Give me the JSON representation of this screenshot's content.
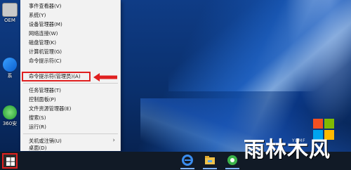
{
  "desktop": {
    "icons": [
      {
        "label": "OEM"
      },
      {
        "label": "系"
      },
      {
        "label": "360安"
      }
    ]
  },
  "context_menu": {
    "items": [
      {
        "label": "事件查看器(V)"
      },
      {
        "label": "系统(Y)"
      },
      {
        "label": "设备管理器(M)"
      },
      {
        "label": "网络连接(W)"
      },
      {
        "label": "磁盘管理(K)"
      },
      {
        "label": "计算机管理(G)"
      },
      {
        "label": "命令提示符(C)"
      },
      {
        "label": "命令提示符(管理员)(A)",
        "highlighted": true
      },
      {
        "label": "任务管理器(T)"
      },
      {
        "label": "控制面板(P)"
      },
      {
        "label": "文件资源管理器(E)"
      },
      {
        "label": "搜索(S)"
      },
      {
        "label": "运行(R)"
      },
      {
        "label": "关机或注销(U)",
        "has_submenu": true
      },
      {
        "label": "桌面(D)"
      }
    ]
  },
  "taskbar": {
    "pinned": [
      {
        "icon": "edge-browser-icon"
      },
      {
        "icon": "file-explorer-icon"
      },
      {
        "icon": "360-browser-icon"
      }
    ]
  },
  "watermark": {
    "brand": "雨林木风",
    "sub": "YLMF"
  },
  "colors": {
    "highlight_border": "#e02020",
    "arrow": "#e02020",
    "menu_bg": "#f2f2f2",
    "taskbar_bg": "#111a26"
  }
}
